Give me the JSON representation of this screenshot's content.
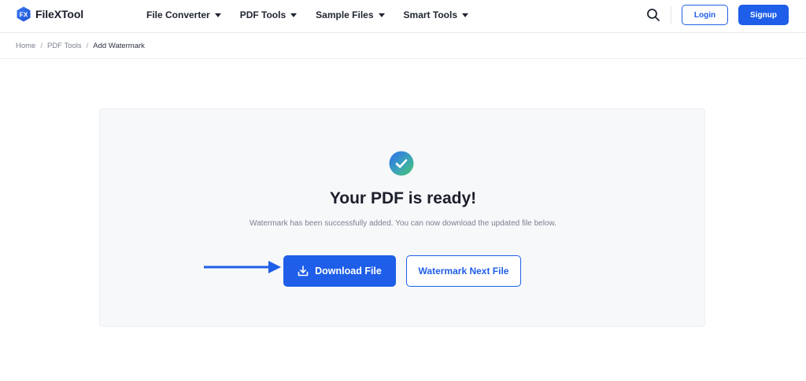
{
  "brand": {
    "logo_mark_text": "FX",
    "name": "FileXTool",
    "accent": "#1e5ee8"
  },
  "nav": {
    "items": [
      {
        "label": "File Converter"
      },
      {
        "label": "PDF Tools"
      },
      {
        "label": "Sample Files"
      },
      {
        "label": "Smart Tools"
      }
    ]
  },
  "header": {
    "login_label": "Login",
    "signup_label": "Signup",
    "search_icon": "search-icon"
  },
  "breadcrumb": {
    "items": [
      "Home",
      "PDF Tools",
      "Add Watermark"
    ],
    "separator": "/"
  },
  "result": {
    "status_icon": "check-circle-icon",
    "title": "Your PDF is ready!",
    "message": "Watermark has been successfully added. You can now download the updated file below.",
    "download_label": "Download File",
    "download_icon": "download-icon",
    "next_label": "Watermark Next File",
    "pointer_icon": "arrow-right-icon"
  }
}
